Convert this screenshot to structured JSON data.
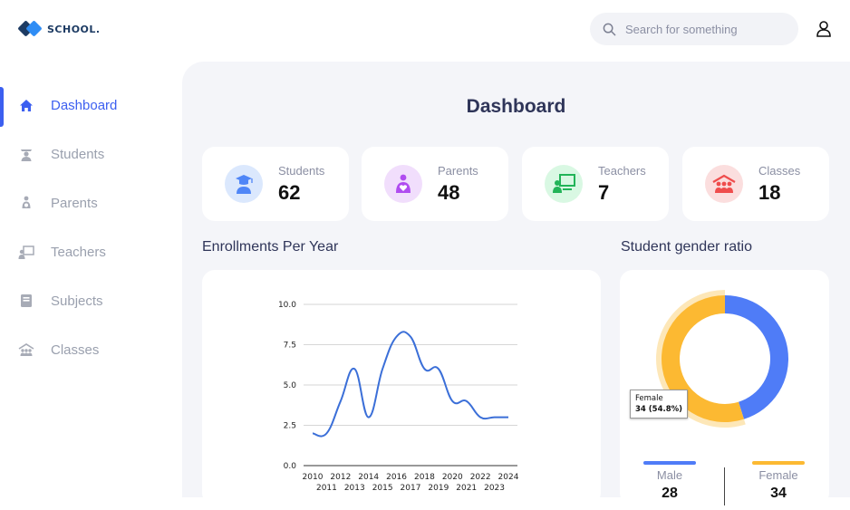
{
  "brand": {
    "name": "SCHOOL."
  },
  "search": {
    "placeholder": "Search for something"
  },
  "sidebar": {
    "items": [
      {
        "label": "Dashboard",
        "icon": "home-icon",
        "active": true
      },
      {
        "label": "Students",
        "icon": "student-icon"
      },
      {
        "label": "Parents",
        "icon": "parent-icon"
      },
      {
        "label": "Teachers",
        "icon": "teacher-icon"
      },
      {
        "label": "Subjects",
        "icon": "book-icon"
      },
      {
        "label": "Classes",
        "icon": "classes-icon"
      }
    ]
  },
  "page": {
    "title": "Dashboard"
  },
  "stats": [
    {
      "label": "Students",
      "value": "62",
      "icon": "graduate-icon",
      "color": "#dbe8fd"
    },
    {
      "label": "Parents",
      "value": "48",
      "icon": "parent-icon",
      "color": "#f1defc"
    },
    {
      "label": "Teachers",
      "value": "7",
      "icon": "teacher-icon",
      "color": "#d9f8e3"
    },
    {
      "label": "Classes",
      "value": "18",
      "icon": "classroom-icon",
      "color": "#fbdede"
    }
  ],
  "enrollments": {
    "title": "Enrollments Per Year"
  },
  "gender": {
    "title": "Student gender ratio",
    "tooltip_label": "Female",
    "tooltip_value": "34 (54.8%)",
    "male_label": "Male",
    "male_value": "28",
    "female_label": "Female",
    "female_value": "34"
  },
  "chart_data": [
    {
      "type": "line",
      "title": "Enrollments Per Year",
      "x": [
        2010,
        2011,
        2012,
        2013,
        2014,
        2015,
        2016,
        2017,
        2018,
        2019,
        2020,
        2021,
        2022,
        2023,
        2024
      ],
      "xtick_labels": [
        "2010",
        "2011",
        "2012",
        "2013",
        "2014",
        "2015",
        "2016",
        "2017",
        "2018",
        "2019",
        "2020",
        "2021",
        "2022",
        "2023",
        "2024"
      ],
      "series": [
        {
          "values": [
            2.0,
            2.0,
            4.0,
            6.0,
            3.0,
            6.0,
            8.0,
            8.0,
            6.0,
            6.0,
            4.0,
            4.0,
            3.0,
            3.0,
            3.0
          ]
        }
      ],
      "ylim": [
        0,
        10
      ],
      "yticks": [
        "0.0",
        "2.5",
        "5.0",
        "7.5",
        "10.0"
      ],
      "grid": true,
      "color": "#3b6fd8"
    },
    {
      "type": "pie",
      "title": "Student gender ratio",
      "categories": [
        "Male",
        "Female"
      ],
      "values": [
        28,
        34
      ],
      "colors": [
        "#4f7cf7",
        "#fcb932"
      ]
    }
  ]
}
